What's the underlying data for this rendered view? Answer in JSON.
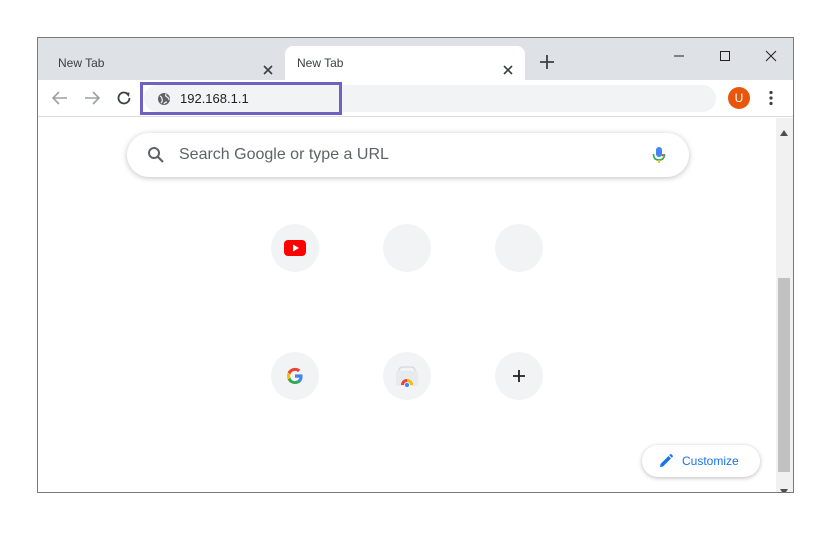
{
  "tabs": [
    {
      "label": "New Tab",
      "active": false
    },
    {
      "label": "New Tab",
      "active": true
    }
  ],
  "toolbar": {
    "url": "192.168.1.1",
    "avatar_letter": "U",
    "avatar_color": "#e8560d",
    "highlight_color": "#6d62c2"
  },
  "search": {
    "placeholder": "Search Google or type a URL"
  },
  "shortcuts": [
    {
      "name": "youtube",
      "icon": "youtube-icon"
    },
    {
      "name": "blank-1",
      "icon": ""
    },
    {
      "name": "blank-2",
      "icon": ""
    },
    {
      "name": "google",
      "icon": "google-g-icon"
    },
    {
      "name": "chrome-web-store",
      "icon": "chrome-web-store-icon"
    },
    {
      "name": "add-shortcut",
      "icon": "plus-icon"
    }
  ],
  "customize": {
    "label": "Customize",
    "accent": "#1a73e8"
  }
}
